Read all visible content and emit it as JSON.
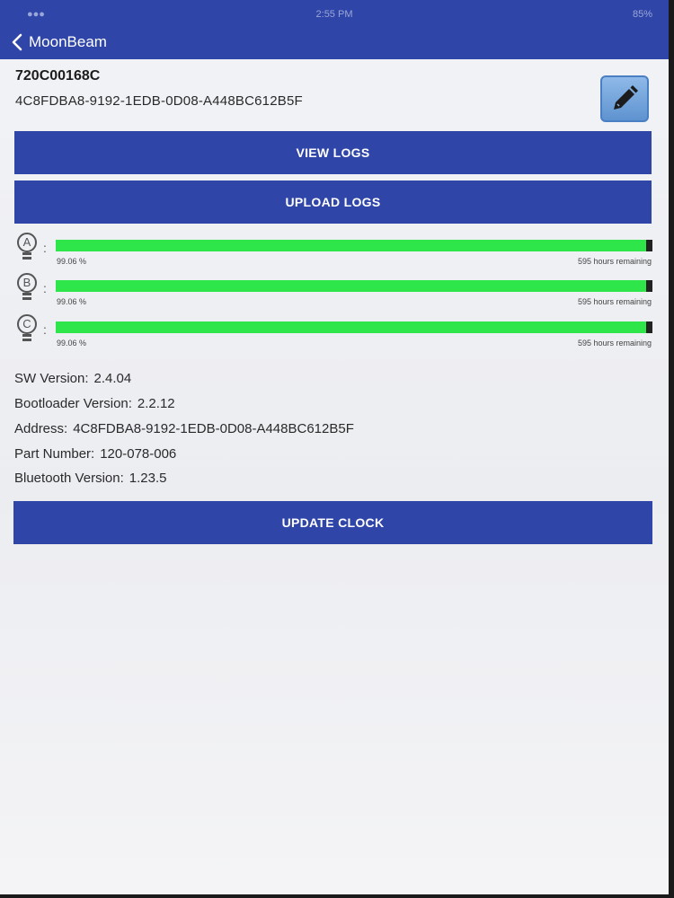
{
  "header": {
    "status_time": "2:55 PM",
    "status_battery": "85%",
    "back_label": "MoonBeam",
    "color": "#2f45a8"
  },
  "device": {
    "id": "720C00168C",
    "uuid": "4C8FDBA8-9192-1EDB-0D08-A448BC612B5F"
  },
  "buttons": {
    "view_logs": "VIEW LOGS",
    "upload_logs": "UPLOAD LOGS",
    "update_clock": "UPDATE CLOCK"
  },
  "lamps": [
    {
      "letter": "A",
      "percent_label": "99.06 %",
      "remaining_label": "595 hours remaining",
      "fill_fraction": 0.99
    },
    {
      "letter": "B",
      "percent_label": "99.06 %",
      "remaining_label": "595 hours remaining",
      "fill_fraction": 0.99
    },
    {
      "letter": "C",
      "percent_label": "99.06 %",
      "remaining_label": "595 hours remaining",
      "fill_fraction": 0.99
    }
  ],
  "info": [
    {
      "label": "SW Version:",
      "value": "2.4.04"
    },
    {
      "label": "Bootloader Version:",
      "value": "2.2.12"
    },
    {
      "label": "Address:",
      "value": "4C8FDBA8-9192-1EDB-0D08-A448BC612B5F"
    },
    {
      "label": "Part Number:",
      "value": "120-078-006"
    },
    {
      "label": "Bluetooth Version:",
      "value": "1.23.5"
    }
  ],
  "icons": {
    "back": "chevron-left-icon",
    "edit": "pencil-icon",
    "lamp": "lightbulb-icon"
  },
  "colors": {
    "accent": "#2f45a8",
    "progress": "#2ee54a"
  }
}
